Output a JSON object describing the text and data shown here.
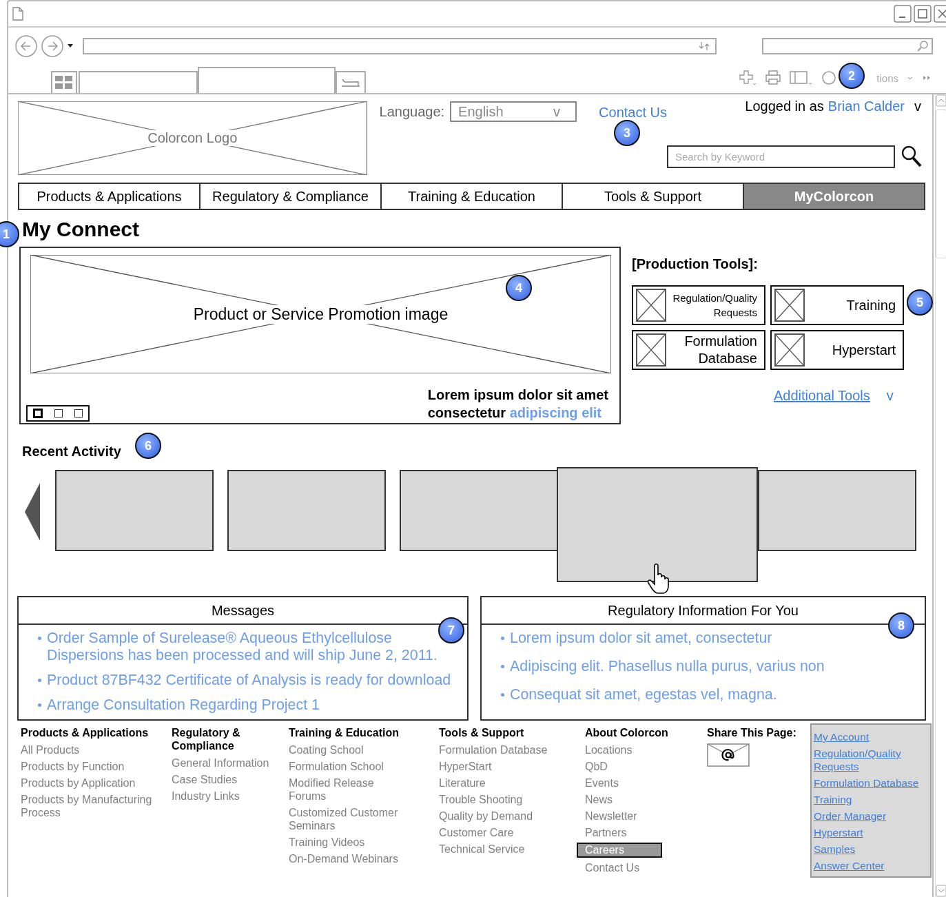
{
  "browser": {
    "menu_fragment": "tions"
  },
  "header": {
    "logo": "Colorcon Logo",
    "language_label": "Language:",
    "language_value": "English",
    "language_caret": "v",
    "contact": "Contact Us",
    "login_prefix": "Logged in as",
    "user": "Brian Calder",
    "user_caret": "v",
    "search_placeholder": "Search by Keyword"
  },
  "nav": [
    {
      "label": "Products & Applications",
      "selected": false
    },
    {
      "label": "Regulatory & Compliance",
      "selected": false
    },
    {
      "label": "Training & Education",
      "selected": false
    },
    {
      "label": "Tools & Support",
      "selected": false
    },
    {
      "label": "MyColorcon",
      "selected": true
    }
  ],
  "page_title": "My Connect",
  "promo": {
    "image_label": "Product or Service Promotion image",
    "caption_line1": "Lorem ipsum dolor sit amet",
    "caption_text": "consectetur",
    "caption_link": "adipiscing elit",
    "dots": [
      {
        "selected": true
      },
      {
        "selected": false
      },
      {
        "selected": false
      }
    ]
  },
  "production_tools": {
    "title": "[Production Tools]:",
    "tools": [
      {
        "label": "Regulation/Quality Requests",
        "kind": "compact"
      },
      {
        "label": "Training",
        "kind": "regular"
      },
      {
        "label": "Formulation Database",
        "kind": "regular"
      },
      {
        "label": "Hyperstart",
        "kind": "regular"
      }
    ],
    "more": "Additional Tools",
    "more_caret": "v"
  },
  "recent_activity": {
    "title": "Recent Activity",
    "cards": [
      {
        "hovered": false
      },
      {
        "hovered": false
      },
      {
        "hovered": false
      },
      {
        "hovered": true
      },
      {
        "hovered": false
      }
    ]
  },
  "messages": {
    "title": "Messages",
    "items": [
      "Order Sample of Surelease® Aqueous Ethylcellulose Dispersions has been processed and will ship June 2, 2011.",
      "Product 87BF432 Certificate of Analysis is ready for download",
      "Arrange Consultation Regarding Project 1"
    ]
  },
  "regulatory": {
    "title": "Regulatory Information For You",
    "items": [
      "Lorem ipsum dolor sit amet, consectetur",
      "Adipiscing elit. Phasellus nulla purus, varius non",
      "Consequat sit amet, egestas vel, magna."
    ]
  },
  "footer": {
    "columns": [
      {
        "title": "Products & Applications",
        "links": [
          {
            "label": "All Products",
            "selected": false
          },
          {
            "label": "Products by Function",
            "selected": false
          },
          {
            "label": "Products by Application",
            "selected": false
          },
          {
            "label": "Products by Manufacturing Process",
            "selected": false
          }
        ]
      },
      {
        "title": "Regulatory & Compliance",
        "links": [
          {
            "label": "General Information",
            "selected": false
          },
          {
            "label": "Case Studies",
            "selected": false
          },
          {
            "label": "Industry Links",
            "selected": false
          }
        ]
      },
      {
        "title": "Training & Education",
        "links": [
          {
            "label": "Coating School",
            "selected": false
          },
          {
            "label": "Formulation School",
            "selected": false
          },
          {
            "label": "Modified Release Forums",
            "selected": false
          },
          {
            "label": "Customized Customer Seminars",
            "selected": false
          },
          {
            "label": "Training Videos",
            "selected": false
          },
          {
            "label": "On-Demand Webinars",
            "selected": false
          }
        ]
      },
      {
        "title": "Tools & Support",
        "links": [
          {
            "label": "Formulation Database",
            "selected": false
          },
          {
            "label": "HyperStart",
            "selected": false
          },
          {
            "label": "Literature",
            "selected": false
          },
          {
            "label": "Trouble Shooting",
            "selected": false
          },
          {
            "label": "Quality by Demand",
            "selected": false
          },
          {
            "label": "Customer Care",
            "selected": false
          },
          {
            "label": "Technical Service",
            "selected": false
          }
        ]
      },
      {
        "title": "About Colorcon",
        "links": [
          {
            "label": "Locations",
            "selected": false
          },
          {
            "label": "QbD",
            "selected": false
          },
          {
            "label": "Events",
            "selected": false
          },
          {
            "label": "News",
            "selected": false
          },
          {
            "label": "Newsletter",
            "selected": false
          },
          {
            "label": "Partners",
            "selected": false
          },
          {
            "label": "Careers",
            "selected": true
          },
          {
            "label": "Contact Us",
            "selected": false
          }
        ]
      }
    ],
    "share_title": "Share This Page:",
    "quick_links": [
      "My Account",
      "Regulation/Quality Requests",
      "Formulation Database",
      "Training",
      "Order Manager",
      "Hyperstart",
      "Samples",
      "Answer Center"
    ]
  },
  "markers": [
    "1",
    "2",
    "3",
    "4",
    "5",
    "6",
    "7",
    "8"
  ]
}
